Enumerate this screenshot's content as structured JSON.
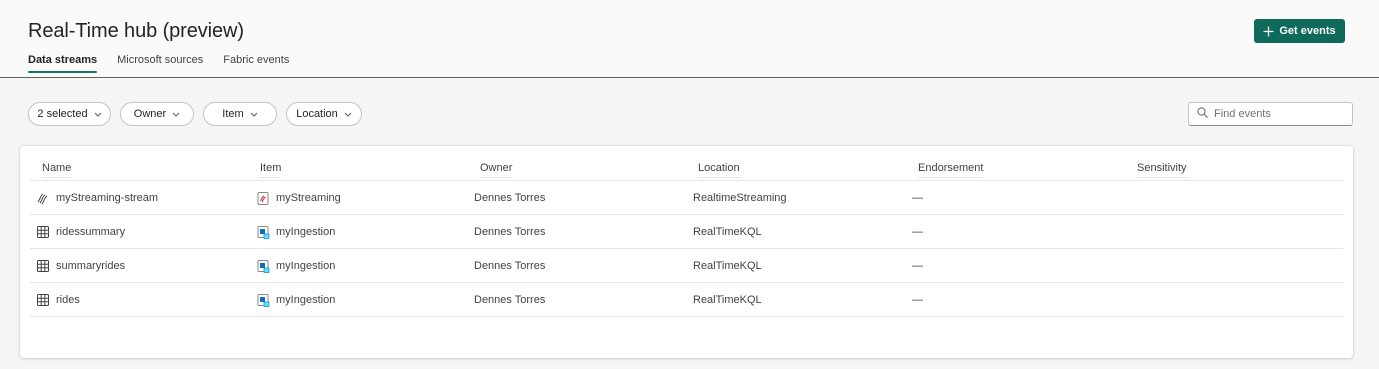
{
  "header": {
    "title": "Real-Time hub (preview)",
    "tabs": [
      {
        "label": "Data streams",
        "active": true
      },
      {
        "label": "Microsoft sources",
        "active": false
      },
      {
        "label": "Fabric events",
        "active": false
      }
    ],
    "get_events_label": "Get events"
  },
  "filters": [
    {
      "label": "2 selected"
    },
    {
      "label": "Owner"
    },
    {
      "label": "Item"
    },
    {
      "label": "Location"
    }
  ],
  "search": {
    "placeholder": "Find events",
    "value": ""
  },
  "table": {
    "columns": [
      "Name",
      "Item",
      "Owner",
      "Location",
      "Endorsement",
      "Sensitivity"
    ],
    "rows": [
      {
        "name": "myStreaming-stream",
        "name_icon": "eventstream-icon",
        "item": "myStreaming",
        "item_icon": "eventstream-item-icon",
        "owner": "Dennes Torres",
        "location": "RealtimeStreaming",
        "endorsement": "—",
        "sensitivity": ""
      },
      {
        "name": "ridessummary",
        "name_icon": "table-icon",
        "item": "myIngestion",
        "item_icon": "kql-database-icon",
        "owner": "Dennes Torres",
        "location": "RealTimeKQL",
        "endorsement": "—",
        "sensitivity": ""
      },
      {
        "name": "summaryrides",
        "name_icon": "table-icon",
        "item": "myIngestion",
        "item_icon": "kql-database-icon",
        "owner": "Dennes Torres",
        "location": "RealTimeKQL",
        "endorsement": "—",
        "sensitivity": ""
      },
      {
        "name": "rides",
        "name_icon": "table-icon",
        "item": "myIngestion",
        "item_icon": "kql-database-icon",
        "owner": "Dennes Torres",
        "location": "RealTimeKQL",
        "endorsement": "—",
        "sensitivity": ""
      }
    ]
  },
  "colors": {
    "accent": "#0e6a5b",
    "tab_underline": "#117865"
  }
}
